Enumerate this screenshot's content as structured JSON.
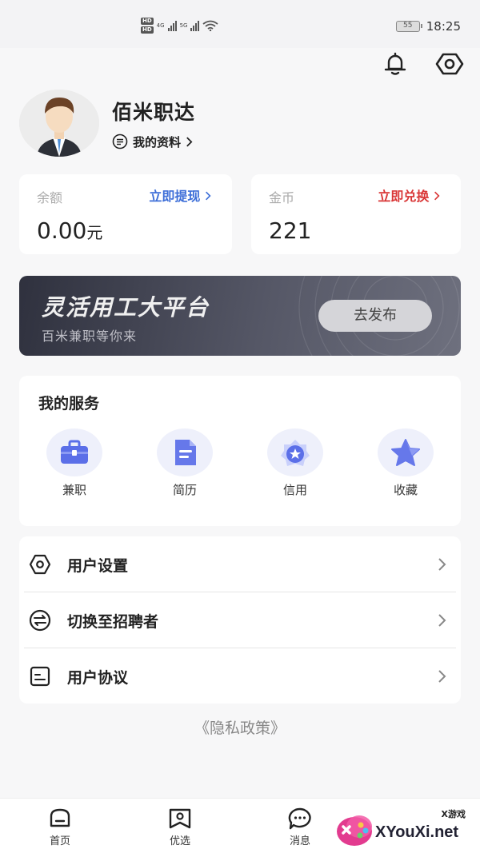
{
  "status_bar": {
    "hd1": "HD",
    "hd2": "HD",
    "net1": "4G",
    "net2": "5G",
    "battery": "55",
    "time": "18:25"
  },
  "header_icons": [
    "bell-icon",
    "settings-hexagon-icon"
  ],
  "profile": {
    "name": "佰米职达",
    "link_label": "我的资料"
  },
  "balance": {
    "label": "余额",
    "action": "立即提现",
    "value": "0.00",
    "unit": "元",
    "action_color": "#3d6ed8"
  },
  "coins": {
    "label": "金币",
    "action": "立即兑换",
    "value": "221",
    "action_color": "#d93636"
  },
  "banner": {
    "title": "灵活用工大平台",
    "subtitle": "百米兼职等你来",
    "button": "去发布"
  },
  "services": {
    "title": "我的服务",
    "items": [
      {
        "label": "兼职",
        "icon": "briefcase-icon"
      },
      {
        "label": "简历",
        "icon": "document-icon"
      },
      {
        "label": "信用",
        "icon": "credit-badge-icon"
      },
      {
        "label": "收藏",
        "icon": "star-icon"
      }
    ]
  },
  "menu": {
    "items": [
      {
        "label": "用户设置",
        "icon": "settings-hexagon-icon"
      },
      {
        "label": "切换至招聘者",
        "icon": "switch-icon"
      },
      {
        "label": "用户协议",
        "icon": "agreement-icon"
      }
    ]
  },
  "privacy": "《隐私政策》",
  "tabs": [
    {
      "label": "首页",
      "icon": "home-icon"
    },
    {
      "label": "优选",
      "icon": "featured-icon"
    },
    {
      "label": "消息",
      "icon": "message-icon"
    }
  ],
  "watermark": {
    "small": "X游戏",
    "text": "XYouXi.net"
  }
}
